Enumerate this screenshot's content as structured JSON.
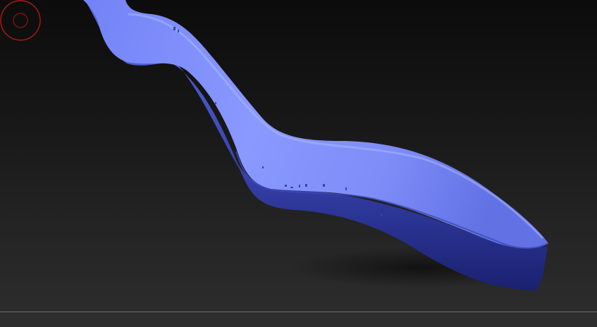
{
  "viewport": {
    "model": "sculpted-ribbon-mesh",
    "material_color": "#7f8eff",
    "background_top": "#0c0c0c",
    "background_bottom": "#2c2c2c"
  },
  "brush": {
    "icon": "brush-cursor-icon",
    "color": "#b01818"
  }
}
